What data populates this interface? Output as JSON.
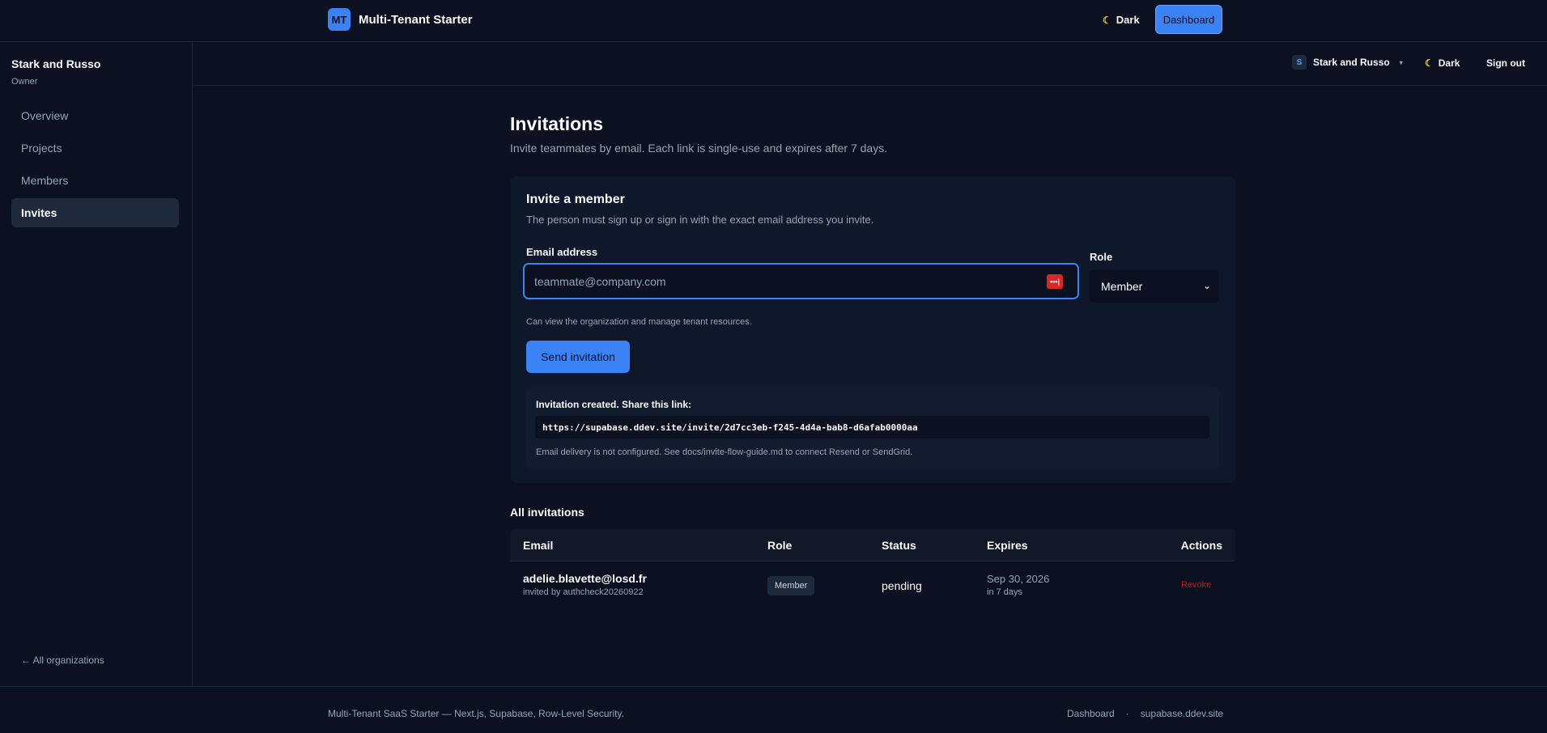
{
  "app": {
    "logo_text": "MT",
    "title": "Multi-Tenant Starter"
  },
  "topbar": {
    "theme_icon": "moon-icon",
    "theme_label": "Dark",
    "dashboard_label": "Dashboard"
  },
  "sidebar": {
    "org_name": "Stark and Russo",
    "org_role": "Owner",
    "items": [
      {
        "label": "Overview"
      },
      {
        "label": "Projects"
      },
      {
        "label": "Members"
      },
      {
        "label": "Invites",
        "active": true
      }
    ],
    "back_link": "← All organizations"
  },
  "subbar": {
    "org_initial": "S",
    "org_name": "Stark and Russo",
    "caret": "▾",
    "theme_label": "Dark",
    "sign_out": "Sign out"
  },
  "page": {
    "title": "Invitations",
    "subtitle": "Invite teammates by email. Each link is single-use and expires after 7 days."
  },
  "invite_card": {
    "title": "Invite a member",
    "subtitle": "The person must sign up or sign in with the exact email address you invite.",
    "email_label": "Email address",
    "email_placeholder": "teammate@company.com",
    "email_value": "",
    "pw_icon_text": "•••|",
    "role_label": "Role",
    "role_value": "Member",
    "role_help": "Can view the organization and manage tenant resources.",
    "send_label": "Send invitation",
    "notice": {
      "title": "Invitation created. Share this link:",
      "link": "https://supabase.ddev.site/invite/2d7cc3eb-f245-4d4a-bab8-d6afab0000aa",
      "footer": "Email delivery is not configured. See docs/invite-flow-guide.md to connect Resend or SendGrid."
    }
  },
  "invitations": {
    "title": "All invitations",
    "columns": {
      "email": "Email",
      "role": "Role",
      "status": "Status",
      "expires": "Expires",
      "actions": "Actions"
    },
    "rows": [
      {
        "email": "adelie.blavette@losd.fr",
        "invited_by": "invited by authcheck20260922",
        "role": "Member",
        "status": "pending",
        "expires": "Sep 30, 2026",
        "expires_relative": "in 7 days",
        "action": "Revoke"
      }
    ]
  },
  "footer": {
    "text": "Multi-Tenant SaaS Starter — Next.js, Supabase, Row-Level Security.",
    "links": [
      {
        "label": "Dashboard"
      },
      {
        "label": "supabase.ddev.site"
      }
    ],
    "separator": "·"
  },
  "colors": {
    "accent": "#3b82f6",
    "background": "#0b1120",
    "danger": "#b91c1c"
  }
}
